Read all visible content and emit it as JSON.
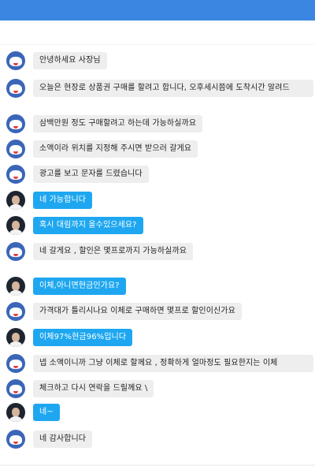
{
  "header": {
    "accent": "#3a86e0"
  },
  "colors": {
    "other_bubble": "#eeeeee",
    "own_bubble": "#1ea7f0"
  },
  "messages": [
    {
      "sender": "shop",
      "avatar_icon": "cartoon-mascot-avatar-icon",
      "text": "안녕하세요 사장님"
    },
    {
      "sender": "shop",
      "avatar_icon": "cartoon-mascot-avatar-icon",
      "text": "오늘은 현장로 상품권 구매를 할려고 합니다, 오후세시쯤에 도착시간 알려드"
    },
    {
      "sender": "shop",
      "avatar_icon": "cartoon-mascot-avatar-icon",
      "text": "삼백만원 정도 구매할려고 하는데 가능하실까요"
    },
    {
      "sender": "shop",
      "avatar_icon": "cartoon-mascot-avatar-icon",
      "text": "소액이라 위치를 지정해 주시면 받으러 갈게요"
    },
    {
      "sender": "shop",
      "avatar_icon": "cartoon-mascot-avatar-icon",
      "text": "광고를 보고 문자를 드렸습니다"
    },
    {
      "sender": "boss",
      "avatar_icon": "person-photo-avatar-icon",
      "text": "네 가능합니다"
    },
    {
      "sender": "boss",
      "avatar_icon": "person-photo-avatar-icon",
      "text": "혹시 대림까지 올수있으세요?"
    },
    {
      "sender": "shop",
      "avatar_icon": "cartoon-mascot-avatar-icon",
      "text": "네 갈게요 , 할인은 몇프로까지 가능하실까요"
    },
    {
      "sender": "boss",
      "avatar_icon": "person-photo-avatar-icon",
      "text": "이체,아니면현금인가요?"
    },
    {
      "sender": "shop",
      "avatar_icon": "cartoon-mascot-avatar-icon",
      "text": "가격대가 틀리시나요 이체로 구매하면 몇프로 할인이신가요"
    },
    {
      "sender": "boss",
      "avatar_icon": "person-photo-avatar-icon",
      "text": "이체97%현금96%입니다"
    },
    {
      "sender": "shop",
      "avatar_icon": "cartoon-mascot-avatar-icon",
      "text": "넵 소액이니까 그냥 이체로 할께요 , 정확하게 얼마정도 필요한지는 이체"
    },
    {
      "sender": "shop",
      "avatar_icon": "cartoon-mascot-avatar-icon",
      "text": "체크하고 다시 연락을 드릴께요 \\"
    },
    {
      "sender": "boss",
      "avatar_icon": "person-photo-avatar-icon",
      "text": "네~"
    },
    {
      "sender": "shop",
      "avatar_icon": "cartoon-mascot-avatar-icon",
      "text": "네 감사합니다"
    }
  ]
}
